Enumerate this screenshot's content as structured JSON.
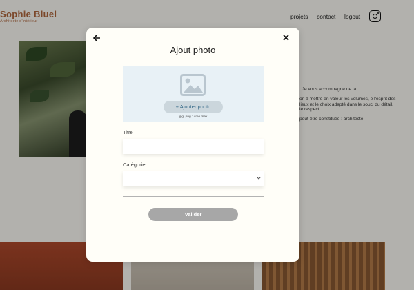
{
  "header": {
    "logo_name": "Sophie Bluel",
    "logo_subtitle": "Architecte d'intérieur",
    "nav": {
      "projets": "projets",
      "contact": "contact",
      "logout": "logout"
    },
    "instagram_icon": "instagram-icon"
  },
  "about": {
    "paragraphs": [
      ". Je vous accompagne de la",
      "on à mettre en valeur les volumes, e l'esprit des lieux et le choix adapté dans le souci du détail, le respect",
      "peut-être constituée : architecte"
    ]
  },
  "modal": {
    "title": "Ajout photo",
    "back_icon": "arrow-left-icon",
    "close_icon": "close-icon",
    "upload": {
      "icon": "image-icon",
      "button_label": "+ Ajouter photo",
      "hint": "jpg, png : 4mo max"
    },
    "title_field": {
      "label": "Titre",
      "value": ""
    },
    "category_field": {
      "label": "Catégorie",
      "value": ""
    },
    "submit_label": "Valider"
  },
  "colors": {
    "brand": "#b1663c",
    "upload_bg": "#e8f1f6",
    "button_disabled": "#a7a7a7",
    "upload_button_text": "#306685"
  }
}
